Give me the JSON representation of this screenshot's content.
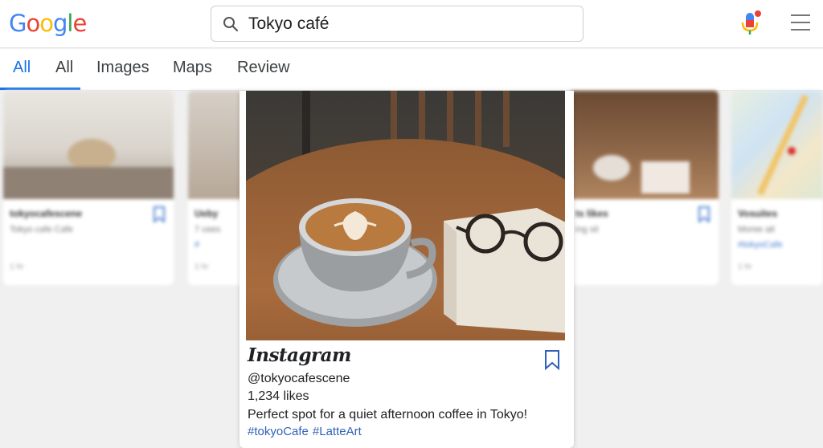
{
  "header": {
    "logo": [
      "G",
      "o",
      "o",
      "g",
      "l",
      "e"
    ],
    "logo_colors": [
      "#4285F4",
      "#EA4335",
      "#FBBC05",
      "#4285F4",
      "#34A853",
      "#EA4335"
    ],
    "search_query": "Tokyo café",
    "mic_icon": "mic-icon",
    "menu_icon": "hamburger-menu-icon"
  },
  "tabs": [
    {
      "label": "All",
      "active": true
    },
    {
      "label": "All"
    },
    {
      "label": "Images"
    },
    {
      "label": "Maps"
    },
    {
      "label": "Review"
    }
  ],
  "accent": "#1a73e8",
  "featured": {
    "source": "Instagram",
    "handle": "@tokyocafescene",
    "likes": "1,234 likes",
    "caption": "Perfect spot for a quiet afternoon coffee in Tokyo!",
    "hashtags": [
      "#tokyoCafe",
      "#LatteArt"
    ],
    "bookmark_icon": "bookmark-icon"
  },
  "background_cards": [
    {
      "title": "tokyocafescene",
      "line1": "Tokyo cafe Cafe",
      "line2": "",
      "footer": "1 hr"
    },
    {
      "title": "Ueby",
      "line1": "7 cees",
      "line2": "#",
      "footer": "1 hr"
    },
    {
      "title": "ts likes",
      "line1": "ing sit",
      "line2": "",
      "footer": ""
    },
    {
      "title": "Vosuites",
      "line1": "Moree ait",
      "line2": "#tokyoCafe",
      "footer": "1 hr"
    }
  ]
}
